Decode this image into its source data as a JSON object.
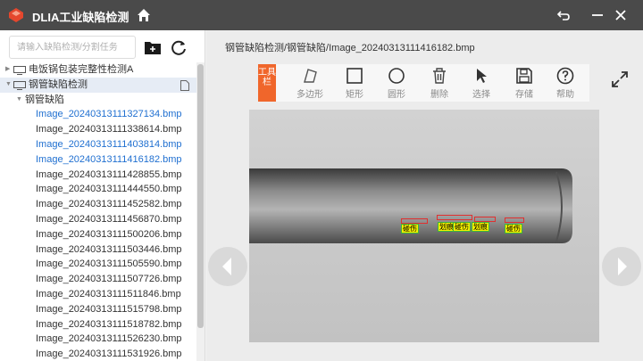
{
  "app": {
    "title": "DLIA工业缺陷检测",
    "brand_color": "#e5472d",
    "titlebar_color": "#4a4a4a",
    "icons": [
      "app-logo-icon",
      "home-icon",
      "back-icon",
      "minimize-icon",
      "close-icon"
    ]
  },
  "sidebar": {
    "search_placeholder": "请输入缺陷检测/分割任务",
    "add_icon": "add-folder-icon",
    "refresh_icon": "refresh-icon",
    "projects": [
      {
        "label": "电饭锅包装完整性检测A",
        "icon": "monitor-icon"
      },
      {
        "label": "钢管缺陷检测",
        "icon": "monitor-icon",
        "selected": true
      }
    ],
    "folder": "钢管缺陷",
    "files": [
      {
        "name": "Image_20240313111327134.bmp",
        "highlight": true
      },
      {
        "name": "Image_20240313111338614.bmp",
        "highlight": false
      },
      {
        "name": "Image_20240313111403814.bmp",
        "highlight": true
      },
      {
        "name": "Image_20240313111416182.bmp",
        "highlight": true
      },
      {
        "name": "Image_20240313111428855.bmp",
        "highlight": false
      },
      {
        "name": "Image_20240313111444550.bmp",
        "highlight": false
      },
      {
        "name": "Image_20240313111452582.bmp",
        "highlight": false
      },
      {
        "name": "Image_20240313111456870.bmp",
        "highlight": false
      },
      {
        "name": "Image_20240313111500206.bmp",
        "highlight": false
      },
      {
        "name": "Image_20240313111503446.bmp",
        "highlight": false
      },
      {
        "name": "Image_20240313111505590.bmp",
        "highlight": false
      },
      {
        "name": "Image_20240313111507726.bmp",
        "highlight": false
      },
      {
        "name": "Image_20240313111511846.bmp",
        "highlight": false
      },
      {
        "name": "Image_20240313111515798.bmp",
        "highlight": false
      },
      {
        "name": "Image_20240313111518782.bmp",
        "highlight": false
      },
      {
        "name": "Image_20240313111526230.bmp",
        "highlight": false
      },
      {
        "name": "Image_20240313111531926.bmp",
        "highlight": false
      }
    ]
  },
  "main": {
    "breadcrumb": "钢管缺陷检测/钢管缺陷/Image_20240313111416182.bmp",
    "toolbar_label": "工具栏",
    "tools": [
      {
        "label": "多边形",
        "icon": "polygon-icon"
      },
      {
        "label": "矩形",
        "icon": "rectangle-icon"
      },
      {
        "label": "圆形",
        "icon": "circle-icon"
      },
      {
        "label": "删除",
        "icon": "trash-icon"
      },
      {
        "label": "选择",
        "icon": "cursor-icon"
      },
      {
        "label": "存储",
        "icon": "save-icon"
      },
      {
        "label": "帮助",
        "icon": "help-icon"
      }
    ],
    "defect_labels": [
      "碰伤",
      "划痕",
      "碰伤",
      "划痕",
      "碰伤"
    ],
    "colors": {
      "annotation_box": "#e03030",
      "label_bg": "#f4f000",
      "label_border": "#3cb43c"
    }
  }
}
